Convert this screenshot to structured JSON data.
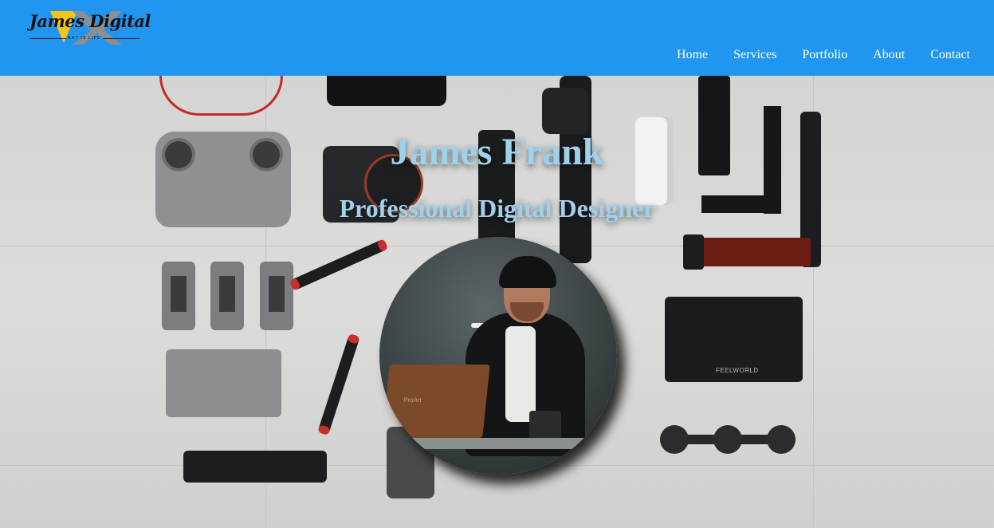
{
  "header": {
    "logo": {
      "script_text": "James Digital",
      "tagline": "ART IS LIFE"
    },
    "nav": [
      {
        "label": "Home"
      },
      {
        "label": "Services"
      },
      {
        "label": "Portfolio"
      },
      {
        "label": "About"
      },
      {
        "label": "Contact"
      }
    ]
  },
  "hero": {
    "title": "James Frank",
    "subtitle": "Professional Digital Designer",
    "monitor_brand": "FEELWORLD",
    "laptop_brand": "ProArt"
  },
  "colors": {
    "header_bg": "#2196f0",
    "hero_text": "#9fd1ec",
    "nav_text": "#ffffff"
  }
}
